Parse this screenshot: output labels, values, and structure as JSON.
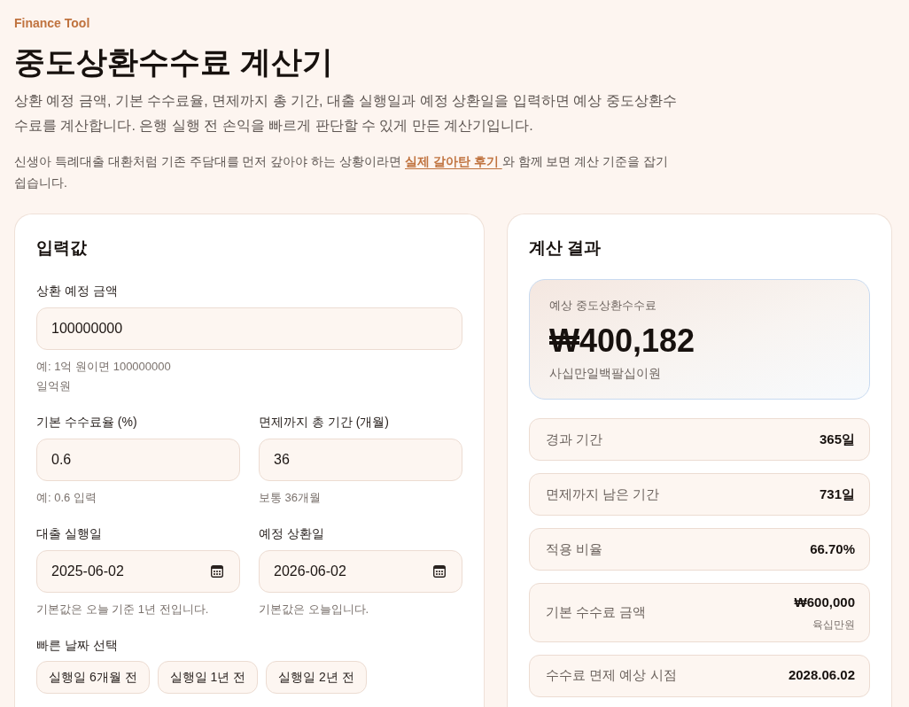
{
  "header": {
    "eyebrow": "Finance Tool",
    "title": "중도상환수수료 계산기",
    "description": "상환 예정 금액, 기본 수수료율, 면제까지 총 기간, 대출 실행일과 예정 상환일을 입력하면 예상 중도상환수수료를 계산합니다. 은행 실행 전 손익을 빠르게 판단할 수 있게 만든 계산기입니다.",
    "note": {
      "before": "신생아 특례대출 대환처럼 기존 주담대를 먼저 갚아야 하는 상황이라면 ",
      "link": "실제 갈아탄 후기 ",
      "after": "와 함께 보면 계산 기준을 잡기 쉽습니다."
    }
  },
  "inputs": {
    "title": "입력값",
    "field_rows": [
      [
        {
          "kind": "number",
          "label": "상환 예정 금액",
          "value": "100000000",
          "hints": [
            "예: 1억 원이면 100000000",
            "일억원"
          ]
        }
      ],
      [
        {
          "kind": "number",
          "label": "기본 수수료율 (%)",
          "value": "0.6",
          "hints": [
            "예: 0.6 입력"
          ]
        },
        {
          "kind": "number",
          "label": "면제까지 총 기간 (개월)",
          "value": "36",
          "hints": [
            "보통 36개월"
          ]
        }
      ],
      [
        {
          "kind": "date",
          "label": "대출 실행일",
          "value": "2025-06-02",
          "hints": [
            "기본값은 오늘 기준 1년 전입니다."
          ]
        },
        {
          "kind": "date",
          "label": "예정 상환일",
          "value": "2026-06-02",
          "hints": [
            "기본값은 오늘입니다."
          ]
        }
      ]
    ],
    "quick_dates": {
      "label": "빠른 날짜 선택",
      "buttons": [
        "실행일 6개월 전",
        "실행일 1년 전",
        "실행일 2년 전"
      ]
    }
  },
  "results": {
    "title": "계산 결과",
    "highlight": {
      "label": "예상 중도상환수수료",
      "amount": "₩400,182",
      "words": "사십만일백팔십이원"
    },
    "rows": [
      {
        "label": "경과 기간",
        "value": "365일"
      },
      {
        "label": "면제까지 남은 기간",
        "value": "731일"
      },
      {
        "label": "적용 비율",
        "value": "66.70%"
      },
      {
        "label": "기본 수수료 금액",
        "value": "₩600,000",
        "sub": "육십만원"
      },
      {
        "label": "수수료 면제 예상 시점",
        "value": "2028.06.02"
      }
    ]
  }
}
